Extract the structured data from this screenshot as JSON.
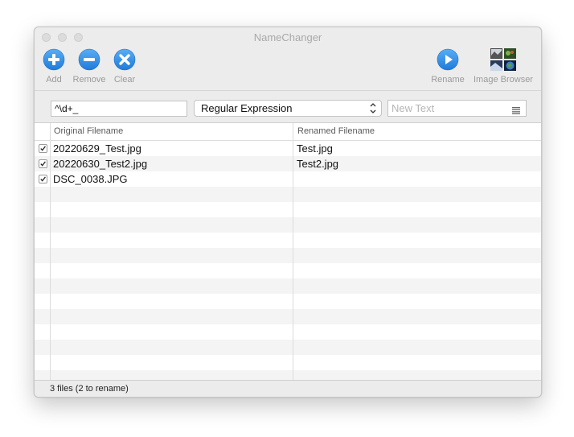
{
  "window": {
    "title": "NameChanger"
  },
  "toolbar": {
    "add_label": "Add",
    "remove_label": "Remove",
    "clear_label": "Clear",
    "rename_label": "Rename",
    "image_browser_label": "Image Browser"
  },
  "filter": {
    "search_value": "^\\d+_",
    "mode_value": "Regular Expression",
    "new_text_placeholder": "New Text"
  },
  "table": {
    "columns": [
      "Original Filename",
      "Renamed Filename"
    ],
    "rows": [
      {
        "checked": true,
        "original": "20220629_Test.jpg",
        "renamed": "Test.jpg"
      },
      {
        "checked": true,
        "original": "20220630_Test2.jpg",
        "renamed": "Test2.jpg"
      },
      {
        "checked": true,
        "original": "DSC_0038.JPG",
        "renamed": ""
      }
    ]
  },
  "status": {
    "text": "3 files (2 to rename)"
  },
  "colors": {
    "accent": "#2d8ce8",
    "row_alt": "#f4f4f4",
    "window_bg": "#ececec"
  },
  "icons": {
    "add": "plus-circle-icon",
    "remove": "minus-circle-icon",
    "clear": "x-circle-icon",
    "rename": "play-circle-icon",
    "image_browser": "photo-grid-icon"
  }
}
